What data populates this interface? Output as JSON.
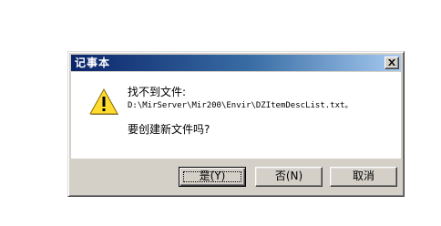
{
  "window": {
    "title": "记事本"
  },
  "message": {
    "line1": "找不到文件:",
    "path": "D:\\MirServer\\Mir200\\Envir\\DZItemDescList.txt。",
    "question": "要创建新文件吗?"
  },
  "buttons": {
    "yes": "是(Y)",
    "no": "否(N)",
    "cancel": "取消"
  },
  "icons": {
    "warning": "warning-triangle-icon",
    "close": "close-icon"
  },
  "colors": {
    "title_bar_start": "#0a246a",
    "title_bar_end": "#a6caf0",
    "dialog_face": "#d4d0c8",
    "warning_yellow": "#ffdc2e"
  }
}
